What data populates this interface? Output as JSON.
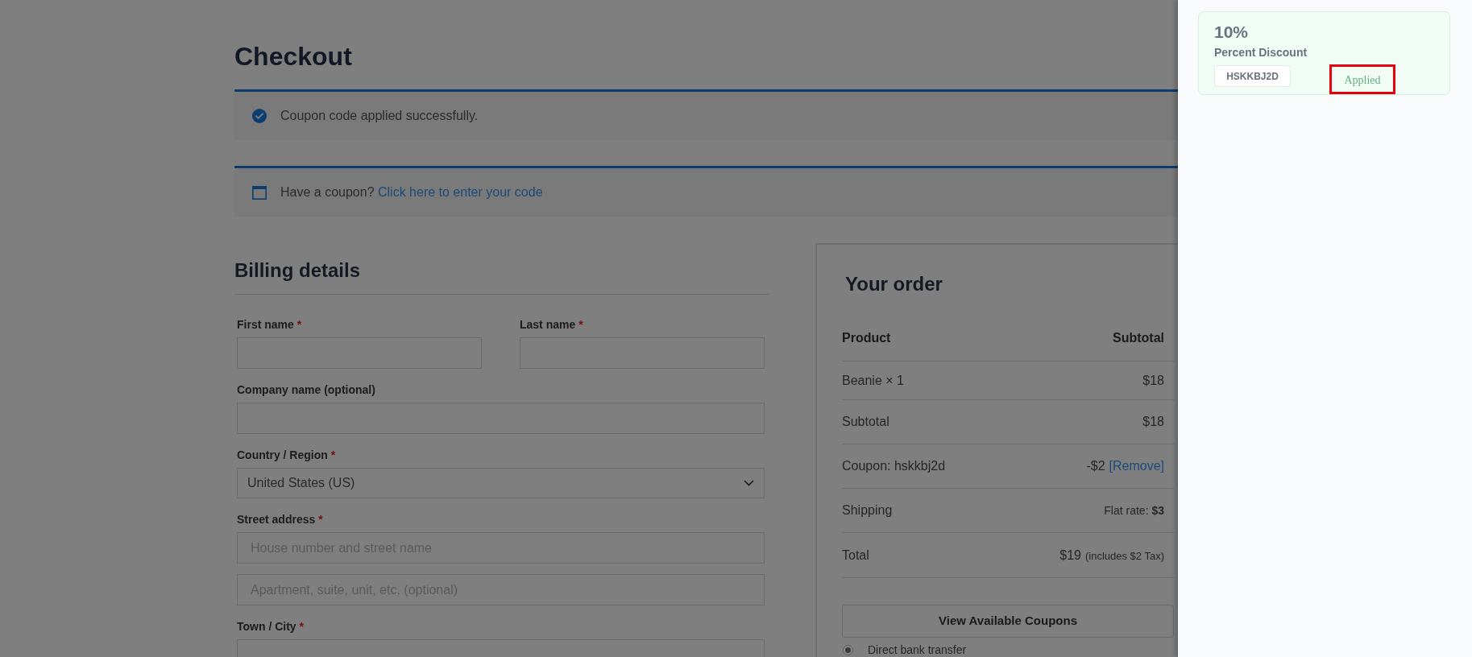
{
  "page": {
    "title": "Checkout"
  },
  "notices": [
    {
      "kind": "success",
      "text": "Coupon code applied successfully."
    },
    {
      "kind": "info",
      "text": "Have a coupon?",
      "link": "Click here to enter your code"
    }
  ],
  "billing": {
    "title": "Billing details",
    "rows": [
      {
        "fields": [
          {
            "kind": "text",
            "label": "First name",
            "required_mark": "*"
          },
          {
            "kind": "text",
            "label": "Last name",
            "required_mark": "*"
          }
        ]
      },
      {
        "fields": [
          {
            "kind": "text",
            "label": "Company name (optional)"
          }
        ]
      },
      {
        "fields": [
          {
            "kind": "select",
            "label": "Country / Region",
            "required_mark": "*",
            "value": "United States (US)"
          }
        ]
      },
      {
        "fields": [
          {
            "kind": "text",
            "label": "Street address",
            "required_mark": "*",
            "placeholders": [
              "House number and street name",
              "Apartment, suite, unit, etc. (optional)"
            ]
          }
        ]
      },
      {
        "fields": [
          {
            "kind": "text",
            "label": "Town / City",
            "required_mark": "*"
          }
        ]
      }
    ]
  },
  "order": {
    "title": "Your order",
    "columns": [
      "Product",
      "Subtotal"
    ],
    "rows": [
      {
        "kind": "item",
        "label": "Beanie × 1",
        "value": "$18"
      },
      {
        "kind": "subtotal",
        "label": "Subtotal",
        "value": "$18"
      },
      {
        "kind": "coupon",
        "label": "Coupon: hskkbj2d",
        "value": "-$2",
        "link": "[Remove]"
      },
      {
        "kind": "shipping",
        "label": "Shipping",
        "value": "Flat rate: **$3**"
      },
      {
        "kind": "total",
        "label": "Total",
        "value": "$19",
        "note": "(includes $2 Tax)"
      }
    ],
    "coupons_button": "View Available Coupons",
    "payment_methods": [
      {
        "label": "Direct bank transfer",
        "selected": true
      }
    ]
  },
  "coupon_drawer": {
    "coupons": [
      {
        "amount": "10%",
        "type": "Percent Discount",
        "code": "HSKKBJ2D",
        "status": "Applied",
        "highlighted": true
      }
    ]
  }
}
